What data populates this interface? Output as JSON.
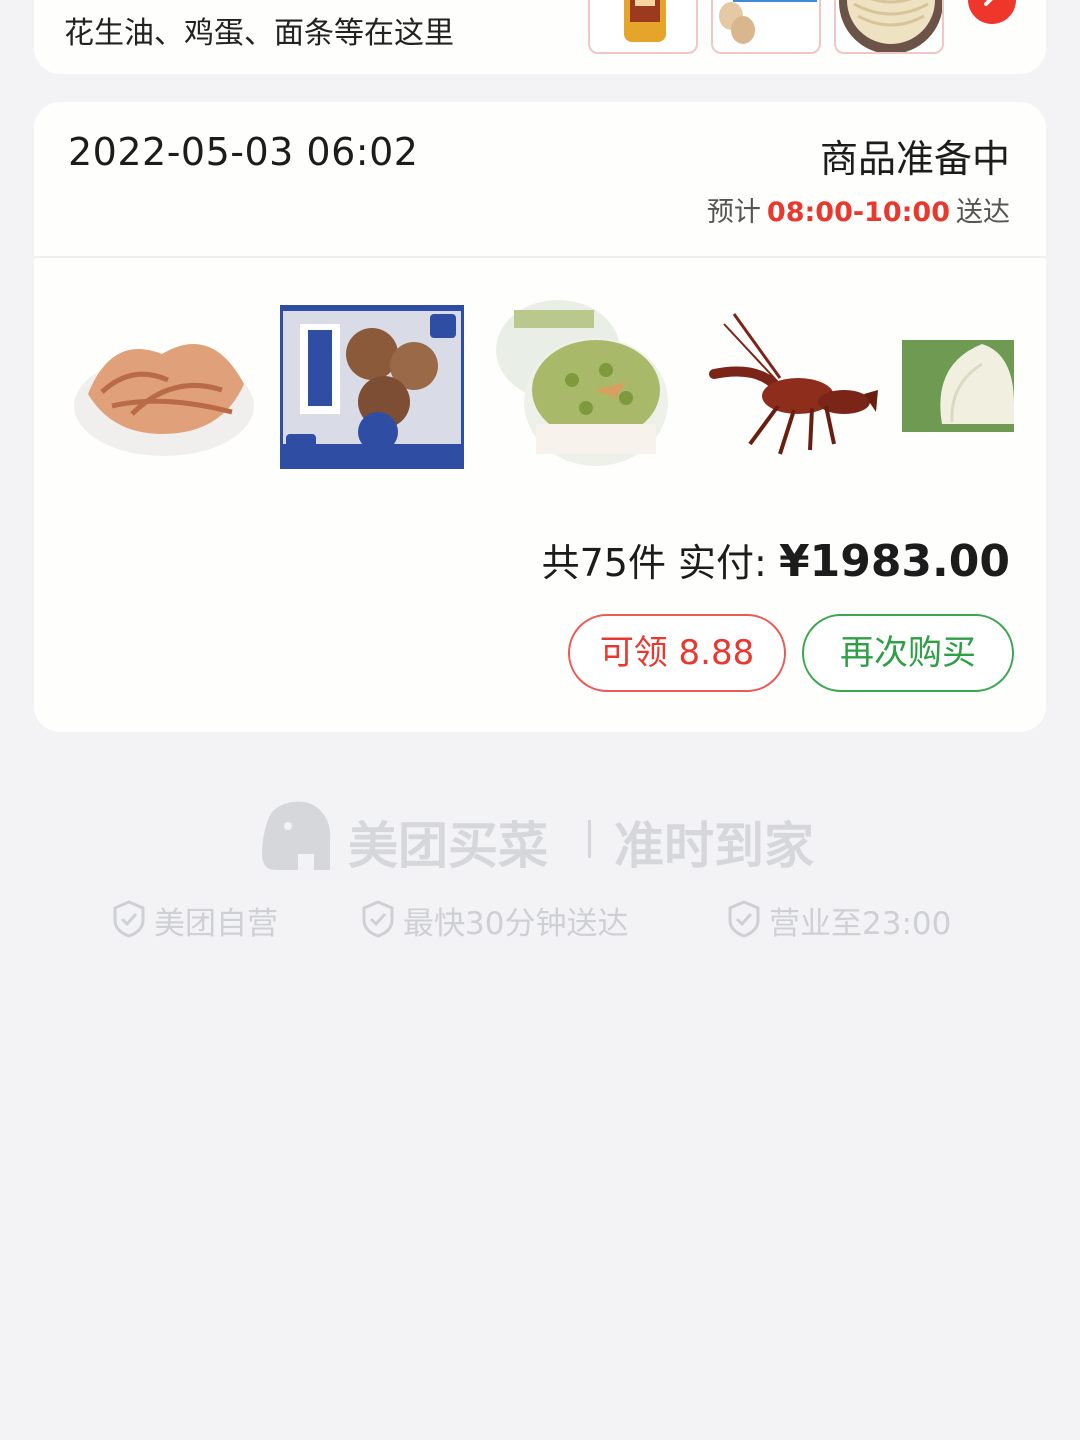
{
  "promo": {
    "text": "花生油、鸡蛋、面条等在这里",
    "thumbs": [
      "peanut-oil-thumb",
      "egg-thumb",
      "noodle-thumb"
    ],
    "arrow_icon": "chevron-right-icon",
    "arrow_color": "#f0352b"
  },
  "order": {
    "time": "2022-05-03 06:02",
    "status": "商品准备中",
    "eta_prefix": "预计",
    "eta_window": "08:00-10:00",
    "eta_suffix": "送达",
    "products": [
      "pig-ear",
      "shaomai",
      "cheese-cake",
      "crayfish",
      "bamboo-shoot"
    ],
    "total_label": "共75件 实付:",
    "total_price": "¥1983.00",
    "coupon_button": "可领 8.88",
    "rebuy_button": "再次购买",
    "colors": {
      "accent_red": "#e8382f",
      "accent_green": "#2f9f45"
    }
  },
  "footer": {
    "brand_name": "美团买菜",
    "slogan": "准时到家",
    "features": [
      {
        "icon": "shield-check-icon",
        "label": "美团自营"
      },
      {
        "icon": "shield-check-icon",
        "label": "最快30分钟送达"
      },
      {
        "icon": "shield-check-icon",
        "label": "营业至23:00"
      }
    ]
  }
}
